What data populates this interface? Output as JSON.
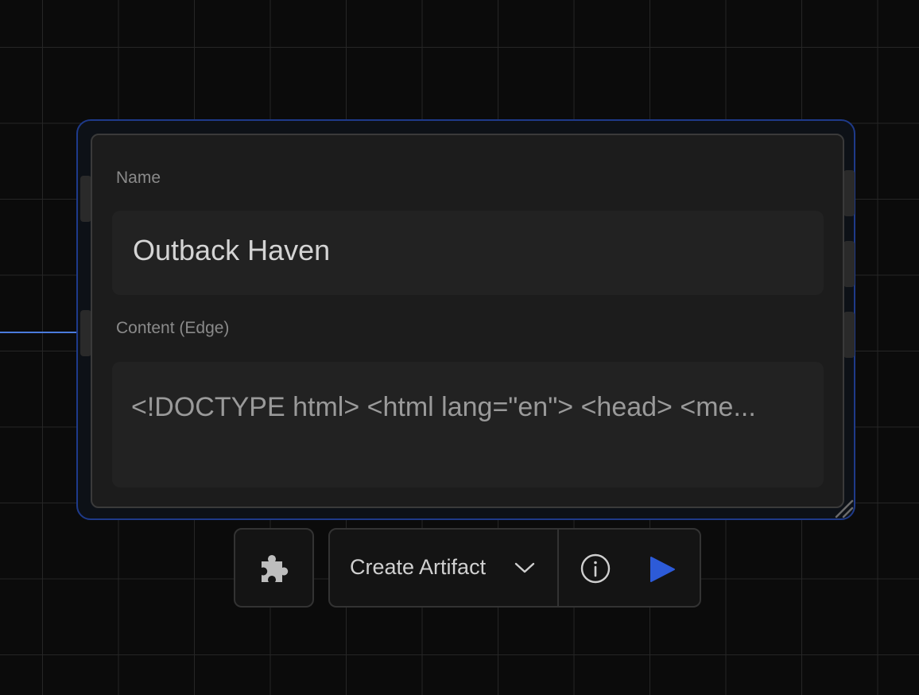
{
  "node": {
    "name_label": "Name",
    "name_value": "Outback Haven",
    "content_label": "Content (Edge)",
    "content_value": "<!DOCTYPE html> <html lang=\"en\"> <head> <me..."
  },
  "toolbar": {
    "plugin_icon": "puzzle-icon",
    "action_label": "Create Artifact",
    "dropdown_icon": "chevron-down-icon",
    "info_icon": "info-icon",
    "run_icon": "play-icon"
  },
  "colors": {
    "background": "#0b0b0b",
    "accent": "#2d5bd8",
    "edge": "#4a7bdc",
    "selection_border": "#1e3a8a"
  }
}
